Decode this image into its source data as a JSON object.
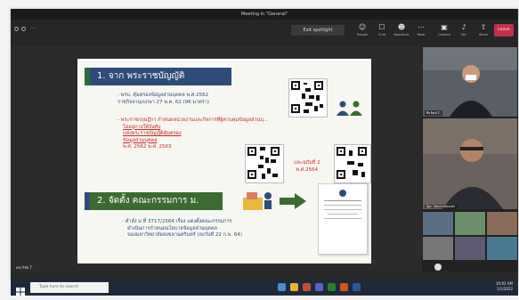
{
  "window": {
    "title": "Meeting in \"General\""
  },
  "toolbar": {
    "spotlight_label": "Exit spotlight",
    "items": [
      {
        "icon": "people-icon",
        "label": "People",
        "glyph": "☺"
      },
      {
        "icon": "chat-icon",
        "label": "Chat",
        "glyph": "☐"
      },
      {
        "icon": "reactions-icon",
        "label": "Reactions",
        "glyph": "☻"
      },
      {
        "icon": "more-icon",
        "label": "More",
        "glyph": "⋯"
      },
      {
        "icon": "camera-icon",
        "label": "Camera",
        "glyph": "▣"
      },
      {
        "icon": "mic-icon",
        "label": "Mic",
        "glyph": "♪"
      },
      {
        "icon": "share-icon",
        "label": "Share",
        "glyph": "⇧"
      }
    ],
    "leave_label": "Leave"
  },
  "slide": {
    "heading1": "1. จาก พระราชบัญญัติ",
    "bullet1_line1": "- พรบ. คุ้มครองข้อมูลส่วนบุคคล พ.ศ.2562",
    "bullet1_line2": "ราชกิจจานุเบกษา 27 พ.ค. 62 (96 มาตรา)",
    "bullet2_line1": "- พระราชกฤษฎีกา กำหนดหน่วยงานและกิจการที่ผู้ควบคุมข้อมูลส่วนบุ...",
    "bullet2_line2": "ไม่อยู่ภายใต้บังคับ",
    "bullet2_line3": "แห่งพระราชบัญญัติคุ้มครอง",
    "bullet2_line4": "ข้อมูลส่วนบุคคล",
    "bullet2_line5": "พ.ศ. 2562  พ.ศ. 2563",
    "edition2_line1": "และฉบับที่ 2",
    "edition2_line2": "พ.ศ.2564",
    "heading2": "2. จัดตั้ง คณะกรรมการ ม.",
    "order_line1": "- คำสั่ง ม ที่ 3717/2564 เรื่อง แต่งตั้งคณะกรรมการ",
    "order_line2": "ดำเนินการกำหนดนโยบายข้อมูลส่วนบุคคล",
    "order_line3": "ของมหาวิทยาลัยสงขลานครินทร์ (ลงวันที่ 22 ก.พ. 64)"
  },
  "presenter_name": "พระวิชัย T.",
  "participants": {
    "tile1_name": "ชีรวัฒน์ T.",
    "tile2_name": "Ajp. Vanchailesder"
  },
  "taskbar": {
    "search_placeholder": "Type here to search",
    "time": "10:02 AM",
    "date": "1/1/2022"
  }
}
